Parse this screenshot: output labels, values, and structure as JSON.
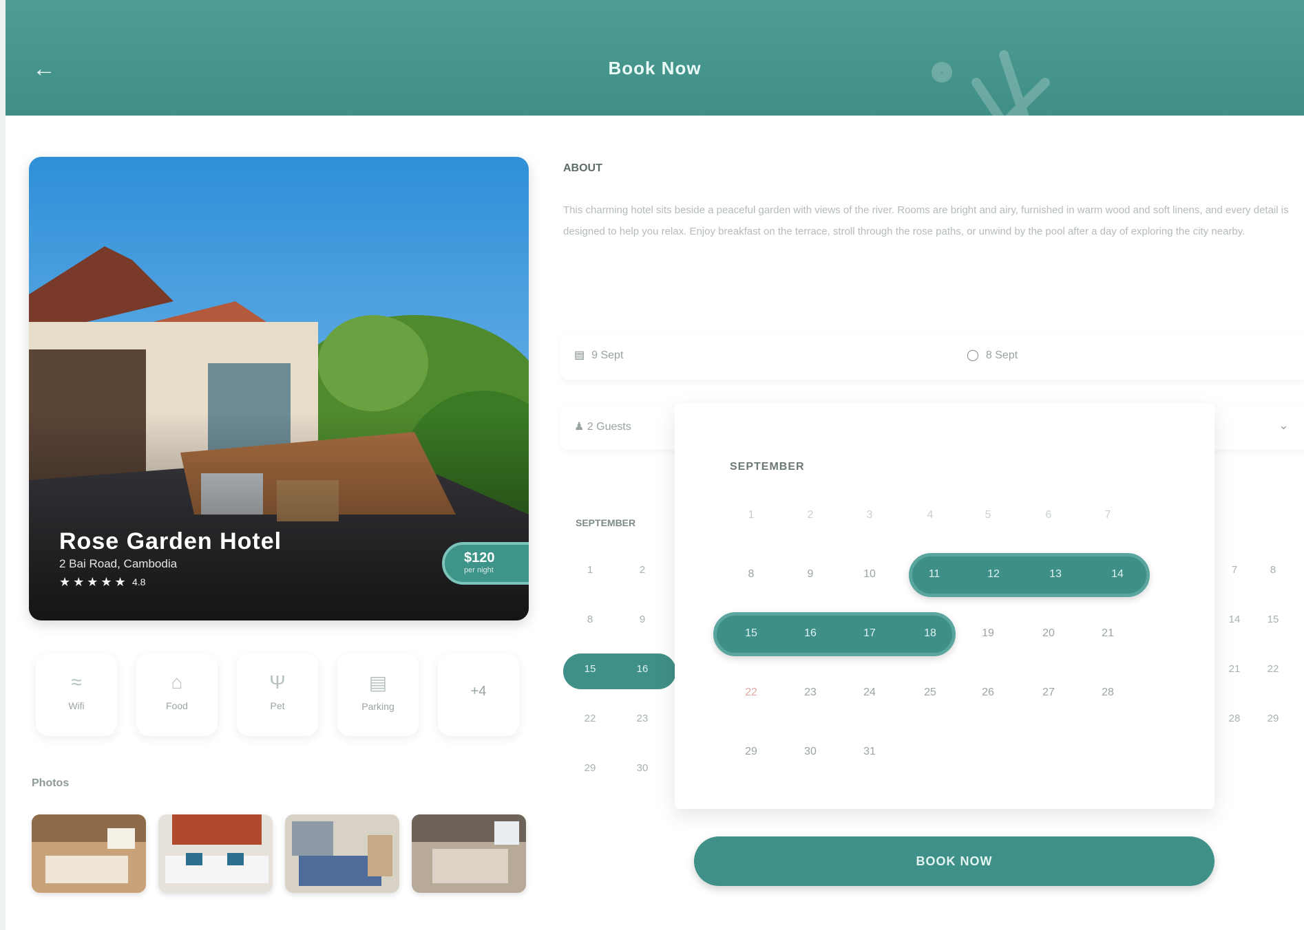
{
  "header": {
    "title": "Book Now",
    "back_icon": "arrow-left-icon"
  },
  "hotel": {
    "name": "Rose Garden Hotel",
    "address": "2 Bai Road, Cambodia",
    "stars": "★★★★★",
    "rating": "4.8",
    "price": "$120",
    "price_unit": "per night"
  },
  "amenities": [
    {
      "icon": "wifi-icon",
      "label": "Wifi"
    },
    {
      "icon": "home-icon",
      "label": "Food"
    },
    {
      "icon": "pet-icon",
      "label": "Pet"
    },
    {
      "icon": "parking-icon",
      "label": "Parking"
    },
    {
      "icon": "more-icon",
      "label": "+4"
    }
  ],
  "photos": {
    "label": "Photos"
  },
  "about": {
    "title": "ABOUT",
    "text": "This charming hotel sits beside a peaceful garden with views of the river. Rooms are bright and airy, furnished in warm wood and soft linens, and every detail is designed to help you relax. Enjoy breakfast on the terrace, stroll through the rose paths, or unwind by the pool after a day of exploring the city nearby."
  },
  "info": {
    "date_label": "9 Sept",
    "time_label": "8 Sept"
  },
  "guests": {
    "label": "2 Guests",
    "chevron": "chevron-down-icon"
  },
  "calendar": {
    "month": "SEPTEMBER",
    "popup_month": "SEPTEMBER"
  },
  "book_button": "BOOK NOW",
  "colors": {
    "primary": "#3f9088",
    "header": "#4a9a91"
  }
}
